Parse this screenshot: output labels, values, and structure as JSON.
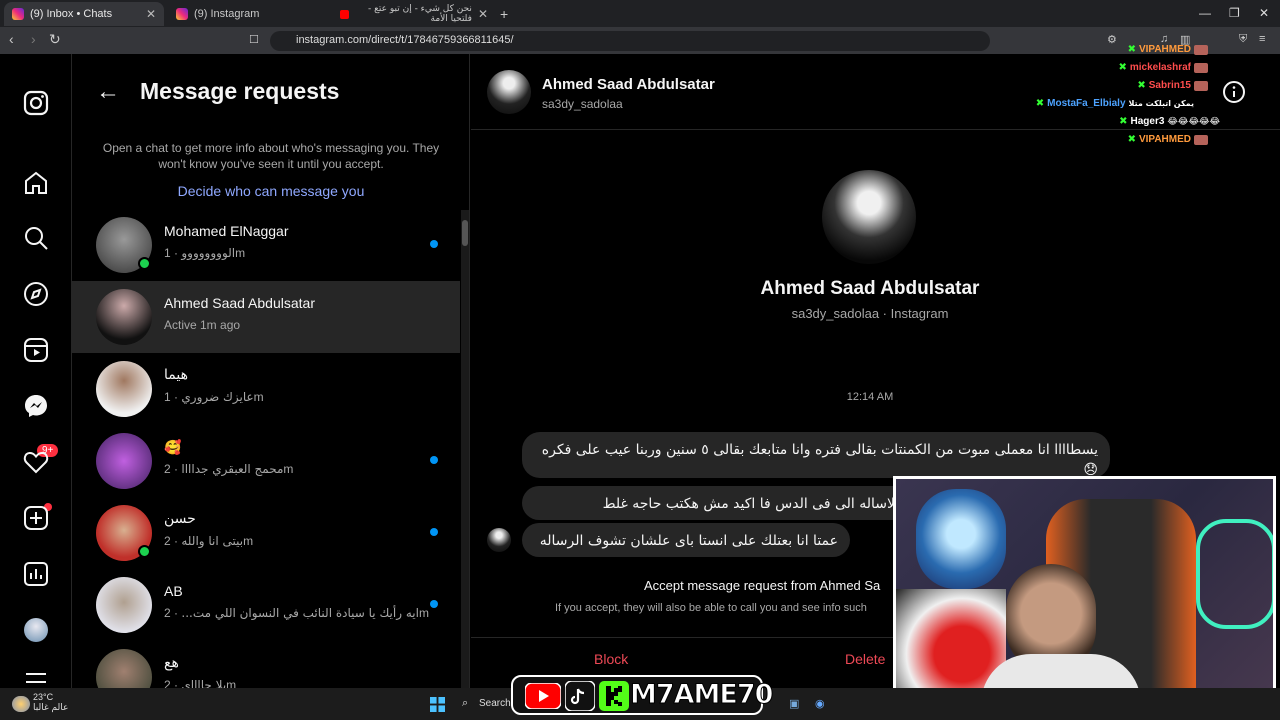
{
  "browser": {
    "tabs": [
      {
        "label": "(9) Inbox • Chats",
        "active": true,
        "icon": "instagram-favicon"
      },
      {
        "label": "(9) Instagram",
        "active": false,
        "icon": "instagram-favicon"
      },
      {
        "label": "نحن كل شيء - إن تبو عتع - فلتحيا الأمة",
        "active": false,
        "icon": "youtube-favicon"
      }
    ],
    "url": "instagram.com/direct/t/17846759366811645/",
    "new_tab": "+",
    "close": "✕"
  },
  "nav": {
    "badge": "9+"
  },
  "requests": {
    "title": "Message requests",
    "info": "Open a chat to get more info about who's messaging you. They won't know you've seen it until you accept.",
    "decide_link": "Decide who can message you",
    "rows": [
      {
        "name": "Mohamed ElNaggar",
        "preview": "الوووووووو",
        "time": "· 1m",
        "online": true,
        "unread": true,
        "selected": false
      },
      {
        "name": "Ahmed Saad Abdulsatar",
        "preview": "Active 1m ago",
        "time": "",
        "online": false,
        "unread": false,
        "selected": true
      },
      {
        "name": "هيما",
        "preview": "عايزك ضروري",
        "time": "· 1m",
        "online": false,
        "unread": false,
        "selected": false
      },
      {
        "name": "🥰",
        "preview": "محمج العبقري جداااا",
        "time": "· 2m",
        "online": false,
        "unread": true,
        "selected": false
      },
      {
        "name": "حسن",
        "preview": "بيتى انا والله",
        "time": "· 2m",
        "online": true,
        "unread": true,
        "selected": false
      },
      {
        "name": "AB",
        "preview": "ايه رأيك يا سيادة النائب في النسوان اللي مت...",
        "time": "· 2m",
        "online": false,
        "unread": true,
        "selected": false
      },
      {
        "name": "هع",
        "preview": "يلا جااااي",
        "time": "· 2m",
        "online": false,
        "unread": false,
        "selected": false
      }
    ]
  },
  "chat": {
    "header_name": "Ahmed Saad Abdulsatar",
    "header_user": "sa3dy_sadolaa",
    "profile_name": "Ahmed Saad Abdulsatar",
    "profile_sub": "sa3dy_sadolaa · Instagram",
    "timestamp": "12:14 AM",
    "messages": [
      "يسطاااا انا معملى مبوت من الكمنتات بقالى فتره وانا متابعك بقالى ٥ سنين وربنا عيب على فكره 😞",
      "العبه الاساله الى فى الدس فا اكيد مش هكتب حاجه غلط",
      "عمتا انا بعتلك على انستا باى علشان تشوف الرساله"
    ],
    "accept_text": "Accept message request from Ahmed Sa",
    "accept_sub": "If you accept, they will also be able to call you and see info such",
    "block_label": "Block",
    "delete_label": "Delete"
  },
  "stream_chat": [
    {
      "user": "VIPAHMED",
      "color": "#ff9a3c",
      "text": ""
    },
    {
      "user": "mickelashraf",
      "color": "#ff4d4d",
      "text": ""
    },
    {
      "user": "Sabrin15",
      "color": "#ff4d4d",
      "text": ""
    },
    {
      "user": "MostaFa_Elbialy",
      "color": "#4da3ff",
      "text": "يمكن اتبلكت متلا"
    },
    {
      "user": "Hager3",
      "color": "#ffffff",
      "text": "😂😂😂😂😂"
    },
    {
      "user": "VIPAHMED",
      "color": "#ff9a3c",
      "text": ""
    }
  ],
  "stream_banner": "M7AME70",
  "taskbar": {
    "temp": "23°C",
    "weather": "عالم غالبا",
    "search": "Search"
  }
}
